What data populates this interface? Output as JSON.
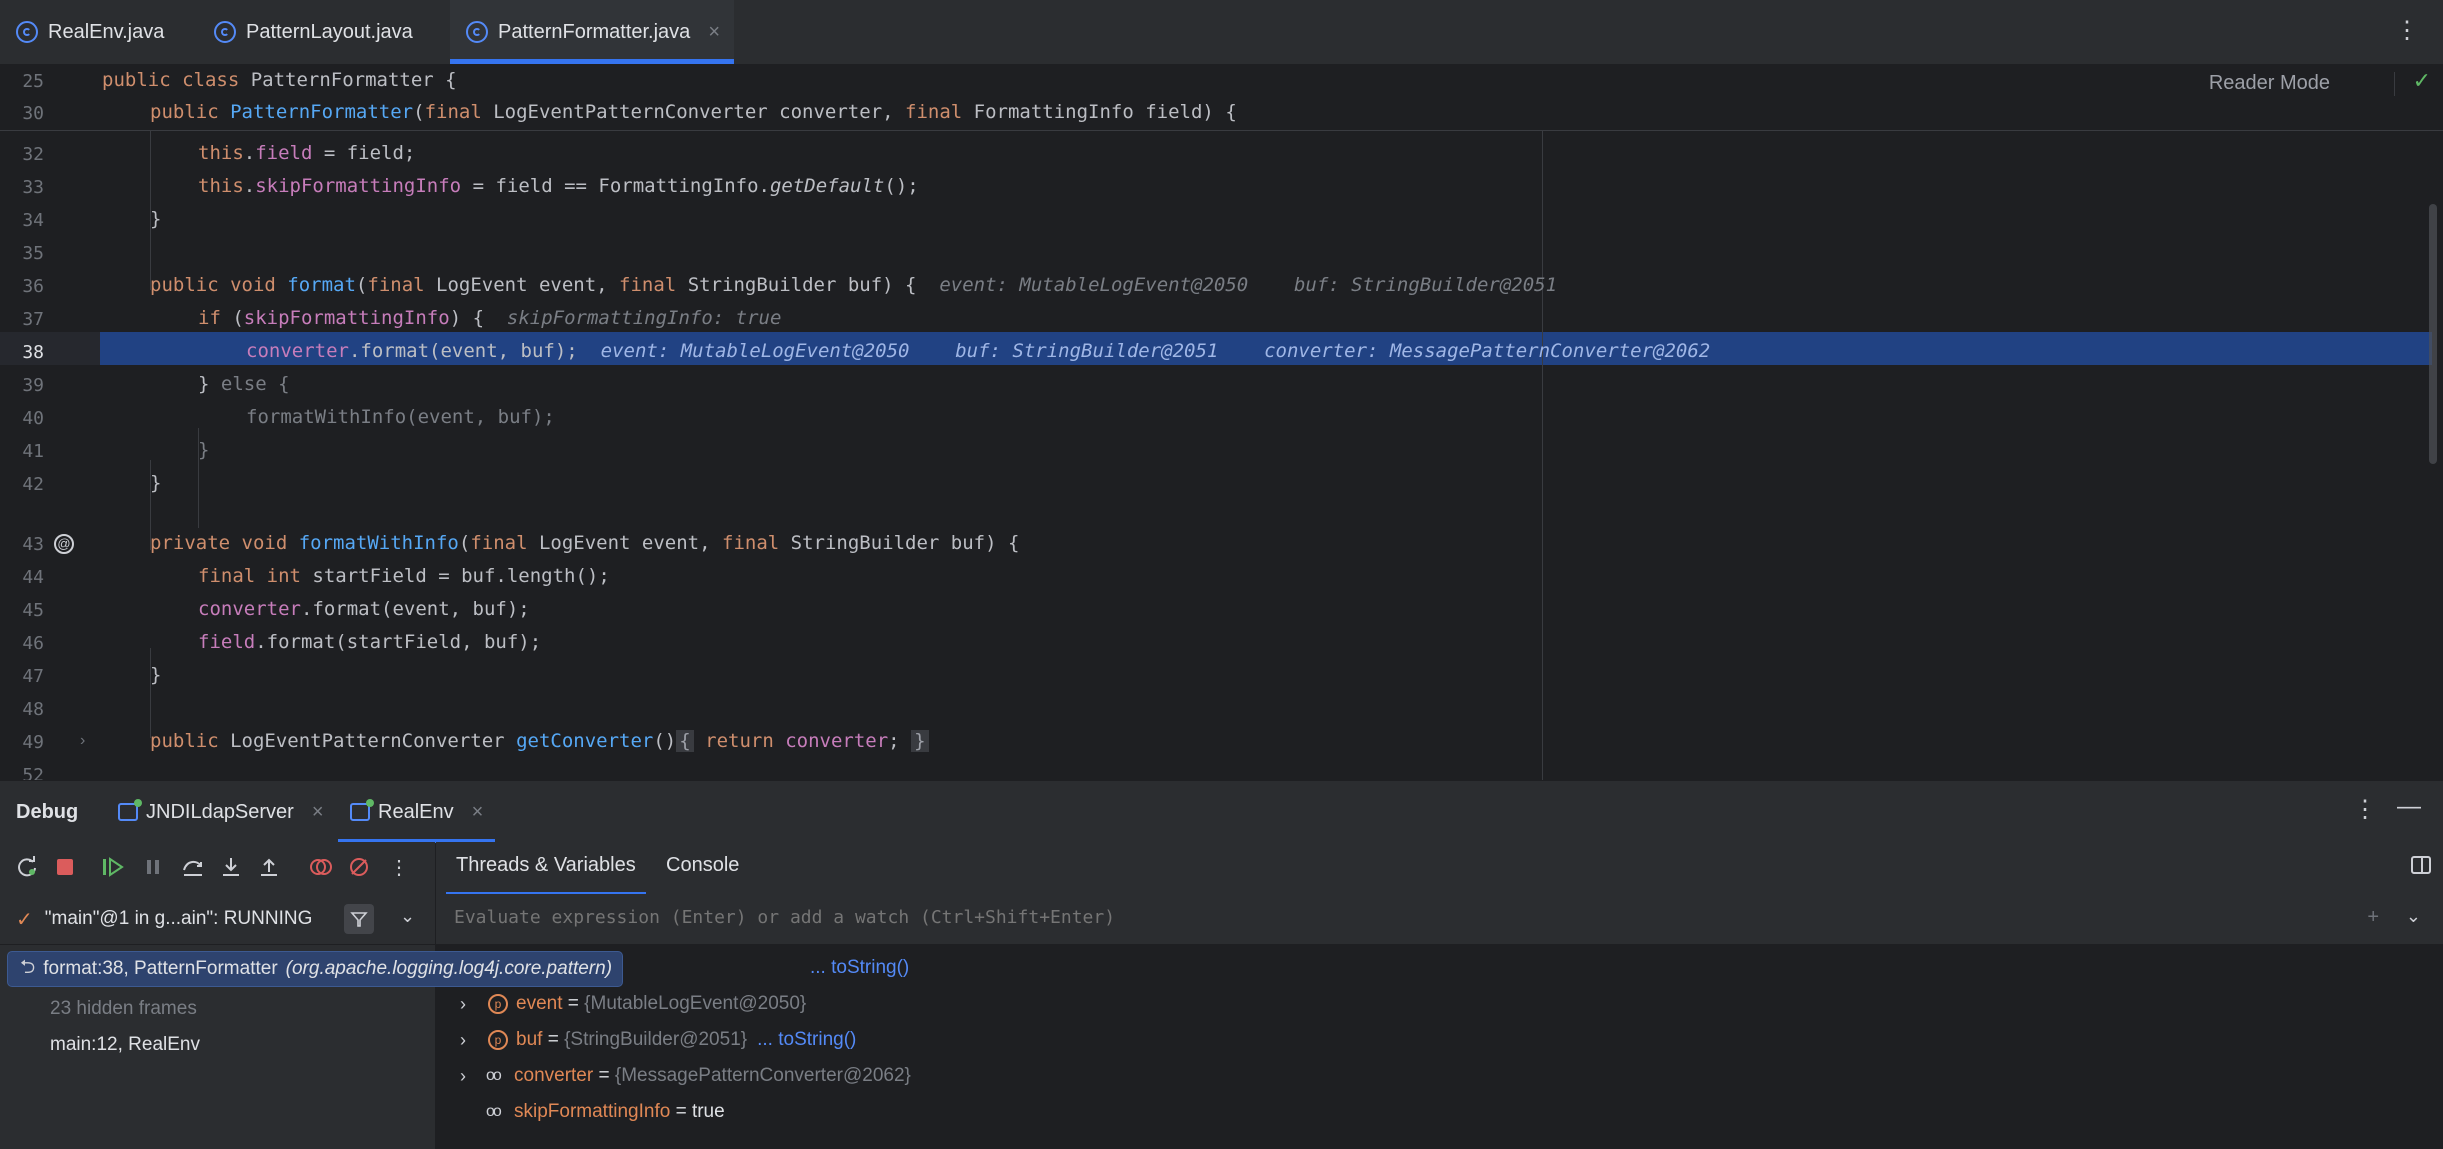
{
  "tabs": [
    {
      "label": "RealEnv.java",
      "icon": "class-run-icon"
    },
    {
      "label": "PatternLayout.java",
      "icon": "class-icon"
    },
    {
      "label": "PatternFormatter.java",
      "icon": "class-icon",
      "active": true,
      "close": "×"
    }
  ],
  "tab_menu": "⋮",
  "editor": {
    "reader_mode": "Reader Mode",
    "reader_check": "✓",
    "sticky": [
      {
        "num": "25",
        "text": "public class PatternFormatter {"
      },
      {
        "num": "30",
        "text": "public PatternFormatter(final LogEventPatternConverter converter, final FormattingInfo field) {"
      }
    ],
    "lines": [
      {
        "num": "32",
        "text": "this.field = field;"
      },
      {
        "num": "33",
        "text": "this.skipFormattingInfo = field == FormattingInfo.getDefault();"
      },
      {
        "num": "34",
        "text": "}"
      },
      {
        "num": "35",
        "text": ""
      },
      {
        "num": "36",
        "text": "public void format(final LogEvent event, final StringBuilder buf) {",
        "hint": "event: MutableLogEvent@2050    buf: StringBuilder@2051"
      },
      {
        "num": "37",
        "text": "if (skipFormattingInfo) {",
        "hint": "skipFormattingInfo: true"
      },
      {
        "num": "38",
        "text": "converter.format(event, buf);",
        "hint": "event: MutableLogEvent@2050    buf: StringBuilder@2051    converter: MessagePatternConverter@2062"
      },
      {
        "num": "39",
        "text": "} else {"
      },
      {
        "num": "40",
        "text": "formatWithInfo(event, buf);"
      },
      {
        "num": "41",
        "text": "}"
      },
      {
        "num": "42",
        "text": "}"
      },
      {
        "num": "43",
        "text": "private void formatWithInfo(final LogEvent event, final StringBuilder buf) {"
      },
      {
        "num": "44",
        "text": "final int startField = buf.length();"
      },
      {
        "num": "45",
        "text": "converter.format(event, buf);"
      },
      {
        "num": "46",
        "text": "field.format(startField, buf);"
      },
      {
        "num": "47",
        "text": "}"
      },
      {
        "num": "48",
        "text": ""
      },
      {
        "num": "49",
        "text": "public LogEventPatternConverter getConverter() { return converter; }"
      },
      {
        "num": "52",
        "text": ""
      }
    ]
  },
  "debug": {
    "title": "Debug",
    "tabs": [
      {
        "label": "JNDILdapServer",
        "close": "×"
      },
      {
        "label": "RealEnv",
        "close": "×",
        "active": true
      }
    ],
    "menu": "⋮",
    "minimize": "—",
    "subtabs": [
      "Threads & Variables",
      "Console"
    ],
    "thread": "\"main\"@1 in g...ain\": RUNNING",
    "frames": [
      {
        "label": "format:38, PatternFormatter",
        "pkg": "(org.apache.logging.log4j.core.pattern)",
        "selected": true
      },
      {
        "label": "23 hidden frames"
      },
      {
        "label": "main:12, RealEnv"
      }
    ],
    "eval_placeholder": "Evaluate expression (Enter) or add a watch (Ctrl+Shift+Enter)",
    "this_link": "... toString()",
    "vars": [
      {
        "name": "event",
        "value": "{MutableLogEvent@2050}",
        "kind": "param"
      },
      {
        "name": "buf",
        "value": "{StringBuilder@2051}",
        "link": "... toString()",
        "kind": "param"
      },
      {
        "name": "converter",
        "value": "{MessagePatternConverter@2062}",
        "kind": "field"
      },
      {
        "name": "skipFormattingInfo",
        "value": "true",
        "kind": "field"
      }
    ]
  },
  "colors": {
    "accent": "#3574f0",
    "selection": "#214283",
    "keyword": "#cf8e6d",
    "method": "#56a8f5",
    "field": "#c77dbb"
  }
}
